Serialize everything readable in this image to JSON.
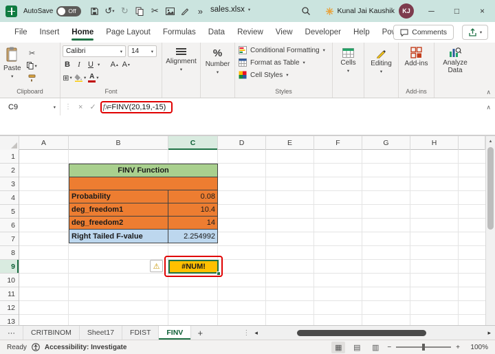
{
  "colors": {
    "excel_green": "#217346",
    "titlebar_teal": "#CBE4DF",
    "table_header_green": "#A9D08E",
    "input_orange": "#ED7D31",
    "result_blue": "#BDD7EE",
    "error_yellow": "#FFC000",
    "annotation_red": "#E00000",
    "avatar_maroon": "#7D3B4D"
  },
  "title_bar": {
    "autosave_label": "AutoSave",
    "autosave_state": "Off",
    "file_name": "sales.xlsx",
    "user_name": "Kunal Jai Kaushik",
    "user_initials": "KJ"
  },
  "menu": {
    "tabs": [
      "File",
      "Insert",
      "Home",
      "Page Layout",
      "Formulas",
      "Data",
      "Review",
      "View",
      "Developer",
      "Help",
      "Power Pivot"
    ],
    "active_tab": "Home",
    "comments_label": "Comments"
  },
  "ribbon": {
    "paste_label": "Paste",
    "clipboard_group_label": "Clipboard",
    "font": {
      "name": "Calibri",
      "size": "14",
      "bold": "B",
      "italic": "I",
      "underline": "U",
      "grow_font": "A",
      "shrink_font": "A",
      "font_color": "A",
      "group_label": "Font"
    },
    "alignment_label": "Alignment",
    "number_label": "Number",
    "number_icon": "%",
    "styles": {
      "conditional_formatting": "Conditional Formatting",
      "format_as_table": "Format as Table",
      "cell_styles": "Cell Styles",
      "group_label": "Styles"
    },
    "cells_label": "Cells",
    "editing_label": "Editing",
    "addins_label": "Add-ins",
    "addins_group_label": "Add-ins",
    "analyze_data_label": "Analyze Data"
  },
  "formula_bar": {
    "name_box": "C9",
    "fx_label": "fx",
    "formula": "=FINV(20,19,-15)"
  },
  "grid": {
    "column_headers": [
      "A",
      "B",
      "C",
      "D",
      "E",
      "F",
      "G",
      "H"
    ],
    "row_headers": [
      "1",
      "2",
      "3",
      "4",
      "5",
      "6",
      "7",
      "8",
      "9",
      "10",
      "11",
      "12",
      "13"
    ],
    "selected_cell": "C9",
    "table": {
      "title": "FINV Function",
      "rows": [
        {
          "label": "Probability",
          "value": "0.08"
        },
        {
          "label": "deg_freedom1",
          "value": "10.4"
        },
        {
          "label": "deg_freedom2",
          "value": "14"
        },
        {
          "label": "Right Tailed F-value",
          "value": "2.254992"
        }
      ]
    },
    "error_value": "#NUM!"
  },
  "sheet_tabs": {
    "tabs": [
      "CRITBINOM",
      "Sheet17",
      "FDIST",
      "FINV"
    ],
    "active_tab": "FINV",
    "add_sheet_label": "+"
  },
  "status_bar": {
    "mode": "Ready",
    "accessibility": "Accessibility: Investigate",
    "zoom_level": "100%"
  }
}
